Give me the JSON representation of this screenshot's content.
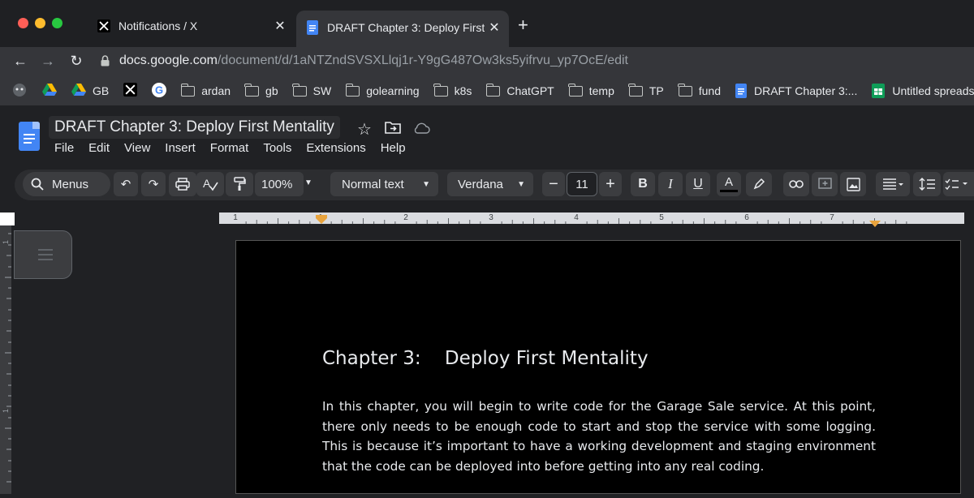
{
  "browser": {
    "tabs": [
      {
        "title": "Notifications / X",
        "icon": "x-logo-icon",
        "active": false
      },
      {
        "title": "DRAFT Chapter 3: Deploy First",
        "icon": "google-docs-icon",
        "active": true
      }
    ],
    "url_host": "docs.google.com",
    "url_path": "/document/d/1aNTZndSVSXLlqj1r-Y9gG487Ow3ks5yifrvu_yp7OcE/edit",
    "bookmarks": [
      {
        "label": "",
        "icon": "extension-icon"
      },
      {
        "label": "",
        "icon": "google-drive-icon"
      },
      {
        "label": "GB",
        "icon": "google-drive-icon"
      },
      {
        "label": "",
        "icon": "x-logo-icon"
      },
      {
        "label": "",
        "icon": "google-icon"
      },
      {
        "label": "ardan",
        "icon": "folder-icon"
      },
      {
        "label": "gb",
        "icon": "folder-icon"
      },
      {
        "label": "SW",
        "icon": "folder-icon"
      },
      {
        "label": "golearning",
        "icon": "folder-icon"
      },
      {
        "label": "k8s",
        "icon": "folder-icon"
      },
      {
        "label": "ChatGPT",
        "icon": "folder-icon"
      },
      {
        "label": "temp",
        "icon": "folder-icon"
      },
      {
        "label": "TP",
        "icon": "folder-icon"
      },
      {
        "label": "fund",
        "icon": "folder-icon"
      },
      {
        "label": "DRAFT Chapter 3:...",
        "icon": "google-docs-icon"
      },
      {
        "label": "Untitled spreads",
        "icon": "google-sheets-icon"
      }
    ]
  },
  "docs": {
    "title": "DRAFT Chapter 3: Deploy First Mentality",
    "menu": [
      "File",
      "Edit",
      "View",
      "Insert",
      "Format",
      "Tools",
      "Extensions",
      "Help"
    ],
    "toolbar": {
      "menus_label": "Menus",
      "zoom": "100%",
      "style": "Normal text",
      "font": "Verdana",
      "font_size": "11"
    },
    "ruler_numbers": [
      "1",
      "1",
      "2",
      "3",
      "4",
      "5",
      "6",
      "7"
    ]
  },
  "document": {
    "chapter_label": "Chapter 3:",
    "chapter_title": "Deploy First Mentality",
    "paragraph": "In this chapter, you will begin to write code for the Garage Sale service. At this point, there only needs to be enough code to start and stop the service with some logging. This is because it’s important to have a working development and staging environment that the code can be deployed into before getting into any real coding."
  },
  "colors": {
    "docs_blue": "#4285f4",
    "ruler_marker": "#e8a33d",
    "sheets_green": "#0f9d58"
  }
}
